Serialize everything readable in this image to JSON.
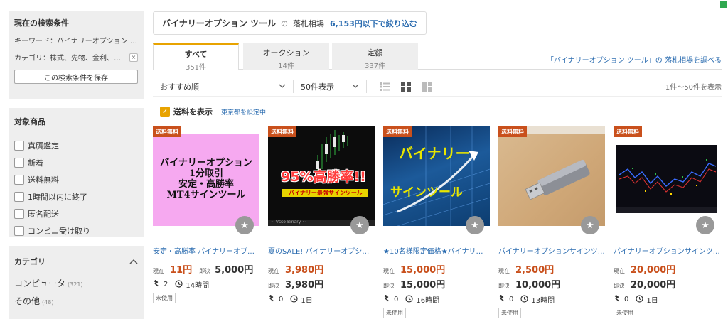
{
  "sidebar": {
    "conditions": {
      "title": "現在の検索条件",
      "keyword": "キーワード：バイナリーオプション …",
      "category": "カテゴリ：株式、先物、金利、ロ…",
      "clear": "×",
      "save_button": "この検索条件を保存"
    },
    "filters": {
      "title": "対象商品",
      "items": [
        "真贋鑑定",
        "新着",
        "送料無料",
        "1時間以内に終了",
        "匿名配送",
        "コンビニ受け取り"
      ]
    },
    "category": {
      "title": "カテゴリ",
      "items": [
        {
          "label": "コンピュータ",
          "count": "(321)"
        },
        {
          "label": "その他",
          "count": "(48)"
        }
      ]
    }
  },
  "query": {
    "keyword": "バイナリーオプション ツール",
    "no": "の",
    "label": "落札相場",
    "link": "6,153円以下で絞り込む"
  },
  "tabs": [
    {
      "label": "すべて",
      "count": "351件"
    },
    {
      "label": "オークション",
      "count": "14件"
    },
    {
      "label": "定額",
      "count": "337件"
    }
  ],
  "tab_link": "「バイナリーオプション ツール」の 落札相場を調べる",
  "toolbar": {
    "sort": "おすすめ順",
    "per_page": "50件表示",
    "result_count": "1件〜50件を表示"
  },
  "shipping": {
    "label": "送料を表示",
    "link": "東京都を設定中"
  },
  "labels": {
    "current": "現在",
    "buynow": "即決",
    "free_ship": "送料無料",
    "used": "未使用"
  },
  "products": [
    {
      "title": "安定・高勝率 バイナリーオプ…",
      "current": "11円",
      "buynow": "5,000円",
      "bids": "2",
      "time": "14時間",
      "condition": "未使用",
      "thumb_text": [
        "バイナリーオプション",
        "1分取引",
        "安定・高勝率",
        "MT4サインツール"
      ]
    },
    {
      "title": "夏のSALE! バイナリーオプショ…",
      "current": "3,980円",
      "buynow": "3,980円",
      "bids": "0",
      "time": "1日",
      "condition": "",
      "thumb_text": [
        "95%高勝率!!",
        "バイナリー最強サインツール",
        "~ Vsso-Binary ~"
      ]
    },
    {
      "title": "★10名様限定価格★バイナリー…",
      "current": "15,000円",
      "buynow": "15,000円",
      "bids": "0",
      "time": "16時間",
      "condition": "未使用",
      "thumb_text": [
        "バイナリー",
        "サインツール"
      ]
    },
    {
      "title": "バイナリーオプションサインツ…",
      "current": "2,500円",
      "buynow": "10,000円",
      "bids": "0",
      "time": "13時間",
      "condition": "未使用",
      "thumb_text": []
    },
    {
      "title": "バイナリーオプションサインツ…",
      "current": "20,000円",
      "buynow": "20,000円",
      "bids": "0",
      "time": "1日",
      "condition": "未使用",
      "thumb_text": []
    }
  ],
  "colors": {
    "accent": "#e8a300",
    "price": "#c9501c",
    "link": "#2b6cb0"
  }
}
